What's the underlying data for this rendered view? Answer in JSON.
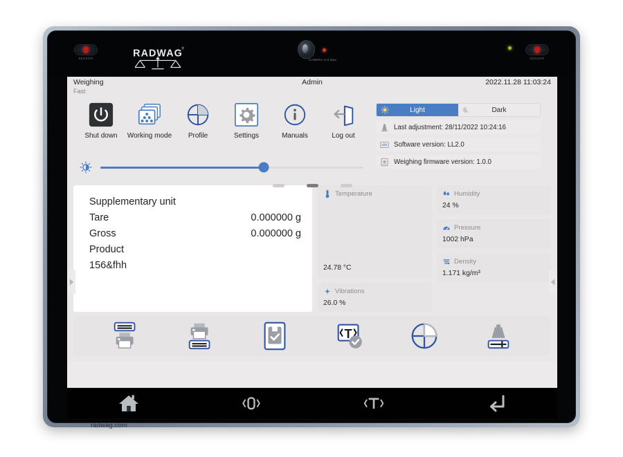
{
  "device": {
    "brand": "RADWAG",
    "camera_label": "CAMERA 8.0 Mpx",
    "sensor_left_label": "SENSOR",
    "sensor_right_label": "SENSOR",
    "footer_url": "radwag.com"
  },
  "titlebar": {
    "mode": "Weighing",
    "submode": "Fast",
    "user": "Admin",
    "datetime": "2022.11.28 11:03:24"
  },
  "shortcuts": [
    {
      "label": "Shut down",
      "icon": "power-icon"
    },
    {
      "label": "Working mode",
      "icon": "working-mode-icon"
    },
    {
      "label": "Profile",
      "icon": "profile-icon"
    },
    {
      "label": "Settings",
      "icon": "gear-icon"
    },
    {
      "label": "Manuals",
      "icon": "info-icon"
    },
    {
      "label": "Log out",
      "icon": "logout-icon"
    }
  ],
  "brightness": {
    "icon": "brightness-icon",
    "value_percent": 62
  },
  "theme": {
    "light_label": "Light",
    "dark_label": "Dark",
    "light_icon": "sun-icon",
    "dark_icon": "moon-icon",
    "active": "Light",
    "accent_color": "#4a7ec4"
  },
  "info_rows": [
    {
      "icon": "weight-adjust-icon",
      "text": "Last adjustment: 28/11/2022 10:24:16"
    },
    {
      "icon": "code-icon",
      "text": "Software version: LL2.0"
    },
    {
      "icon": "scale-icon",
      "text": "Weighing firmware version: 1.0.0"
    }
  ],
  "page_dots": {
    "count": 3,
    "active_index": 1
  },
  "readout": {
    "rows": [
      {
        "label": "Supplementary unit",
        "value": ""
      },
      {
        "label": "Tare",
        "value": "0.000000 g"
      },
      {
        "label": "Gross",
        "value": "0.000000 g"
      },
      {
        "label": "Product",
        "value": ""
      },
      {
        "label": "156&fhh",
        "value": ""
      }
    ]
  },
  "sensor_cards": {
    "left": [
      {
        "icon": "thermometer-icon",
        "title": "Temperature",
        "value": "24.78 °C"
      },
      {
        "icon": "vibration-icon",
        "title": "Vibrations",
        "value": "26.0 %"
      }
    ],
    "right": [
      {
        "icon": "humidity-icon",
        "title": "Humidity",
        "value": "24 %"
      },
      {
        "icon": "pressure-icon",
        "title": "Pressure",
        "value": "1002 hPa"
      },
      {
        "icon": "density-icon",
        "title": "Density",
        "value": "1.171 kg/m³"
      }
    ]
  },
  "edge_arrows": {
    "left": "chevron-right-icon",
    "right": "chevron-left-icon"
  },
  "toolbar": [
    {
      "name": "print-header-button",
      "icon": "print-header-icon"
    },
    {
      "name": "print-footer-button",
      "icon": "print-footer-icon"
    },
    {
      "name": "save-product-button",
      "icon": "save-check-icon"
    },
    {
      "name": "tare-confirm-button",
      "icon": "tare-check-icon"
    },
    {
      "name": "profile-select-button",
      "icon": "profile-quarter-icon"
    },
    {
      "name": "calibration-weight-button",
      "icon": "weight-slider-icon"
    }
  ],
  "navbar": [
    {
      "name": "home-button",
      "icon": "home-icon"
    },
    {
      "name": "zero-button",
      "icon": "zero-icon"
    },
    {
      "name": "tare-button",
      "icon": "tare-icon"
    },
    {
      "name": "enter-button",
      "icon": "enter-icon"
    }
  ]
}
